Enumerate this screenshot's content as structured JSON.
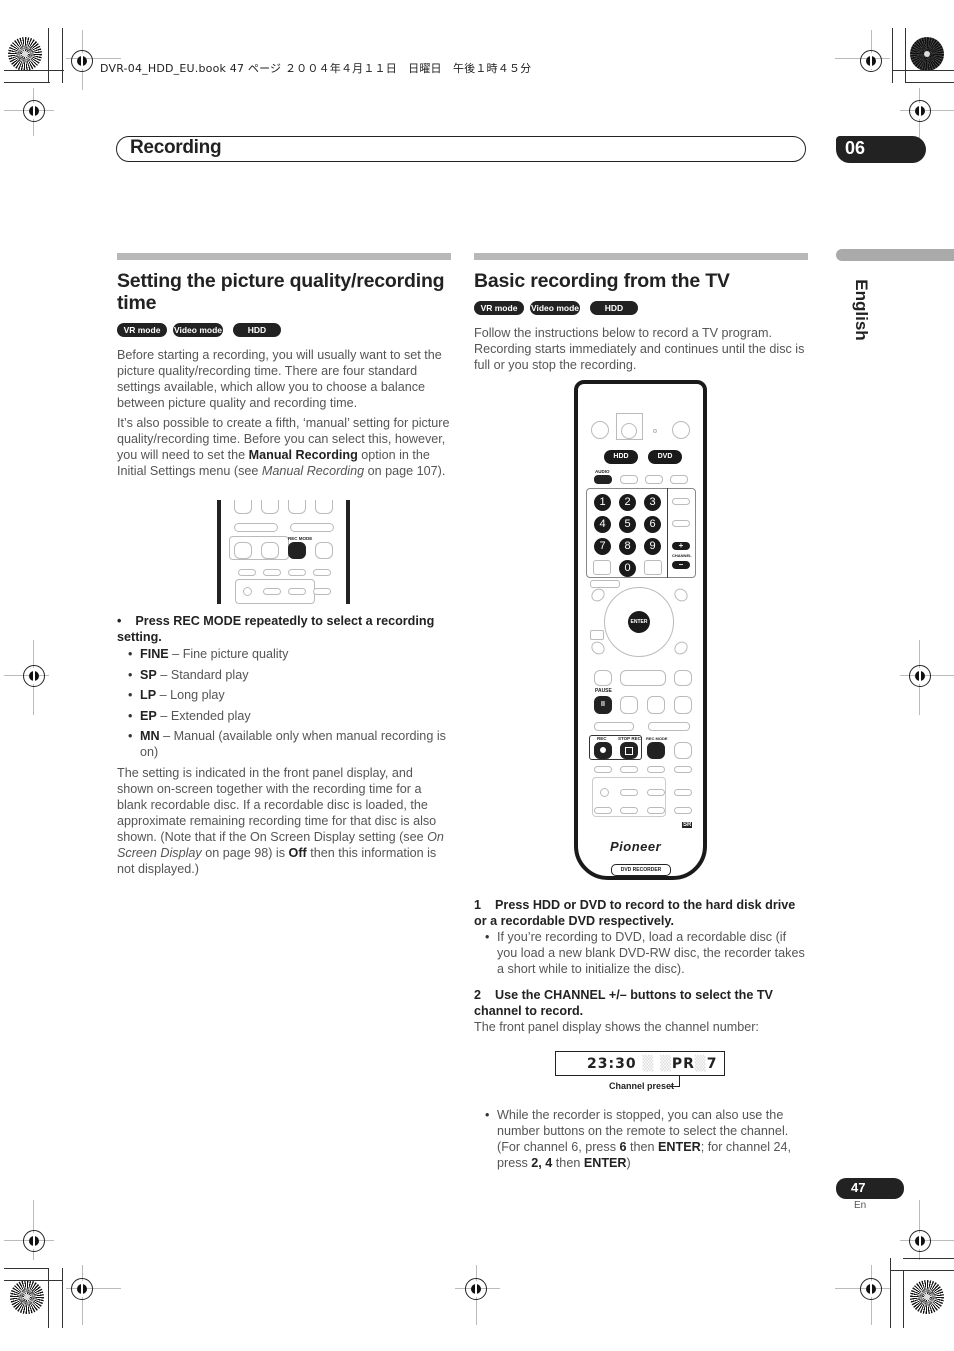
{
  "file_info": "DVR-04_HDD_EU.book  47 ページ  ２００４年４月１１日　日曜日　午後１時４５分",
  "header": {
    "title": "Recording",
    "chapter": "06"
  },
  "side_tab": {
    "language": "English"
  },
  "left_section": {
    "title": "Setting the picture quality/recording time",
    "tags": [
      "VR mode",
      "Video mode",
      "HDD"
    ],
    "para1": "Before starting a recording, you will usually want to set the picture quality/recording time. There are four standard settings available, which allow you to choose a balance between picture quality and recording time.",
    "para2_pre": "It’s also possible to create a fifth, ‘manual’ setting for picture quality/recording time. Before you can select this, however, you will need to set the ",
    "para2_bold": "Manual Recording",
    "para2_mid": " option in the Initial Settings menu (see ",
    "para2_italic": "Manual Recording",
    "para2_post": " on page 107).",
    "illustration_label": "REC MODE",
    "instruction": "Press REC MODE repeatedly to select a recording setting.",
    "modes": [
      {
        "code": "FINE",
        "desc": " – Fine picture quality"
      },
      {
        "code": "SP",
        "desc": " – Standard play"
      },
      {
        "code": "LP",
        "desc": " – Long play"
      },
      {
        "code": "EP",
        "desc": " – Extended play"
      },
      {
        "code": "MN",
        "desc": " – Manual (available only when manual recording is on)"
      }
    ],
    "para3_pre": "The setting is indicated in the front panel display, and shown on-screen together with the recording time for a blank recordable disc. If a recordable disc is loaded, the approximate remaining recording time for that disc is also shown. (Note that if the On Screen Display setting (see ",
    "para3_italic": "On Screen Display",
    "para3_mid": " on page 98) is ",
    "para3_bold": "Off",
    "para3_post": " then this information is not displayed.)"
  },
  "right_section": {
    "title": "Basic recording from the TV",
    "tags": [
      "VR mode",
      "Video mode",
      "HDD"
    ],
    "intro": "Follow the instructions below to record a TV program. Recording starts immediately and continues until the disc is full or you stop the recording.",
    "remote": {
      "hdd": "HDD",
      "dvd": "DVD",
      "audio": "AUDIO",
      "numbers": [
        "1",
        "2",
        "3",
        "4",
        "5",
        "6",
        "7",
        "8",
        "9",
        "0"
      ],
      "channel": "CHANNEL",
      "plus": "+",
      "minus": "–",
      "enter": "ENTER",
      "pause": "PAUSE",
      "pause_glyph": "II",
      "rec": "REC",
      "stop_rec": "STOP REC",
      "rec_mode": "REC MODE",
      "brand": "Pioneer",
      "model_label": "DVD RECORDER",
      "sr_badge": "SR"
    },
    "step1_num": "1",
    "step1": "Press HDD or DVD to record to the hard disk drive or a recordable DVD respectively.",
    "step1_bullet": "If you’re recording to DVD, load a recordable disc (if you load a new blank DVD-RW disc, the recorder takes a short while to initialize the disc).",
    "step2_num": "2",
    "step2": "Use the CHANNEL +/– buttons to select the TV channel to record.",
    "step2_text": "The front panel display shows the channel number:",
    "display": {
      "time": "23:30",
      "preset_label": "PR",
      "preset": "7",
      "caption": "Channel preset"
    },
    "tip_pre": "While the recorder is stopped, you can also use the number buttons on the remote to select the channel. (For channel 6, press ",
    "tip_b1": "6",
    "tip_m1": " then ",
    "tip_b2": "ENTER",
    "tip_m2": "; for channel 24, press ",
    "tip_b3": "2, 4",
    "tip_m3": " then ",
    "tip_b4": "ENTER",
    "tip_post": ")"
  },
  "footer": {
    "page": "47",
    "lang": "En"
  }
}
